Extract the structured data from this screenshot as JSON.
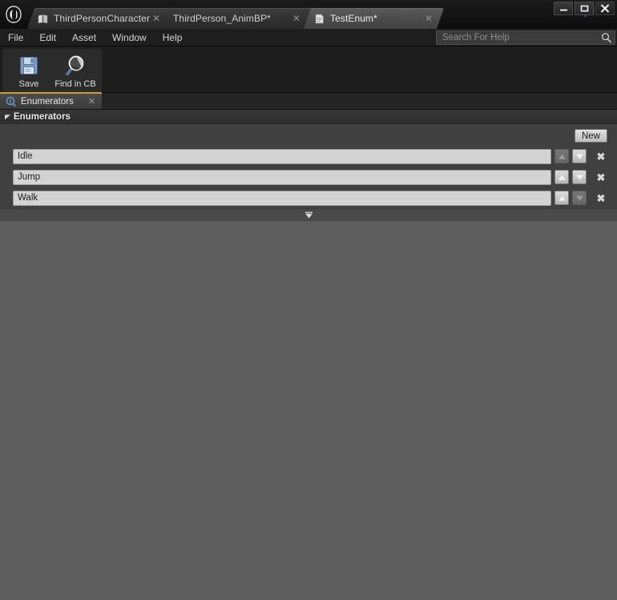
{
  "window": {
    "controls": {
      "minimize": "–",
      "maximize": "□",
      "close": "✕"
    }
  },
  "titlebar": {
    "logo_icon": "unreal-engine-logo-icon",
    "tabs": [
      {
        "label": "ThirdPersonCharacter",
        "icon": "blueprint-icon",
        "close": "✕",
        "active": false
      },
      {
        "label": "ThirdPerson_AnimBP*",
        "icon": "animation-blueprint-icon",
        "close": "✕",
        "active": false
      },
      {
        "label": "TestEnum*",
        "icon": "enum-asset-icon",
        "close": "✕",
        "active": true
      }
    ],
    "right_icons": [
      {
        "name": "feedback-bubble-icon"
      },
      {
        "name": "launcher-diamond-icon"
      }
    ]
  },
  "menubar": {
    "items": [
      "File",
      "Edit",
      "Asset",
      "Window",
      "Help"
    ],
    "search": {
      "placeholder": "Search For Help",
      "value": "",
      "icon": "search-icon"
    }
  },
  "toolbar": {
    "buttons": [
      {
        "label": "Save",
        "icon": "save-floppy-icon"
      },
      {
        "label": "Find in CB",
        "icon": "find-in-content-browser-icon"
      }
    ]
  },
  "doctabs": [
    {
      "label": "Enumerators",
      "icon": "details-info-icon",
      "close": "✕",
      "active": true
    }
  ],
  "details": {
    "category": {
      "title": "Enumerators",
      "expanded": true,
      "arrow_icon": "triangle-down-icon"
    },
    "new_button": {
      "label": "New"
    },
    "enumerators": [
      {
        "value": "Idle",
        "move_up": {
          "icon": "triangle-up-icon",
          "enabled": false
        },
        "move_down": {
          "icon": "triangle-down-icon",
          "enabled": true
        },
        "delete": {
          "icon": "close-x-icon",
          "glyph": "✖"
        }
      },
      {
        "value": "Jump",
        "move_up": {
          "icon": "triangle-up-icon",
          "enabled": true
        },
        "move_down": {
          "icon": "triangle-down-icon",
          "enabled": true
        },
        "delete": {
          "icon": "close-x-icon",
          "glyph": "✖"
        }
      },
      {
        "value": "Walk",
        "move_up": {
          "icon": "triangle-up-icon",
          "enabled": true
        },
        "move_down": {
          "icon": "triangle-down-icon",
          "enabled": false
        },
        "delete": {
          "icon": "close-x-icon",
          "glyph": "✖"
        }
      }
    ],
    "footer_expander_icon": "expander-triangle-down-icon"
  },
  "colors": {
    "accent_tab_underline": "#c8a32a",
    "panel_bg": "#404040",
    "workspace_bg": "#5e5e5e",
    "input_bg": "#d3d3d3",
    "titlebar_bg": "#141414"
  }
}
